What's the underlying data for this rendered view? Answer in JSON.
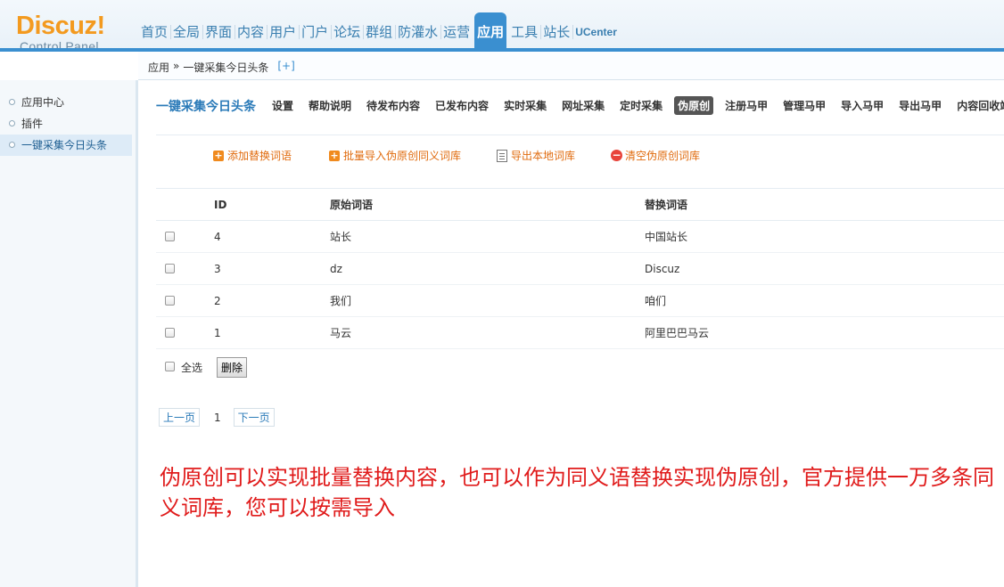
{
  "logo": {
    "word": "Discuz!",
    "sub": "Control Panel"
  },
  "nav": [
    "首页",
    "全局",
    "界面",
    "内容",
    "用户",
    "门户",
    "论坛",
    "群组",
    "防灌水",
    "运营",
    "应用",
    "工具",
    "站长",
    "UCenter"
  ],
  "nav_active": "应用",
  "breadcrumb": {
    "root": "应用",
    "sep": "»",
    "current": "一键采集今日头条",
    "add": "[+]"
  },
  "sidebar": {
    "items": [
      "应用中心",
      "插件",
      "一键采集今日头条"
    ]
  },
  "subnav": {
    "title": "一键采集今日头条",
    "tabs": [
      "设置",
      "帮助说明",
      "待发布内容",
      "已发布内容",
      "实时采集",
      "网址采集",
      "定时采集",
      "伪原创",
      "注册马甲",
      "管理马甲",
      "导入马甲",
      "导出马甲",
      "内容回收站"
    ]
  },
  "actions": [
    "添加替换词语",
    "批量导入伪原创同义词库",
    "导出本地词库",
    "清空伪原创词库"
  ],
  "table": {
    "headers": [
      "ID",
      "原始词语",
      "替换词语"
    ],
    "rows": [
      {
        "id": "4",
        "src": "站长",
        "rep": "中国站长"
      },
      {
        "id": "3",
        "src": "dz",
        "rep": "Discuz"
      },
      {
        "id": "2",
        "src": "我们",
        "rep": "咱们"
      },
      {
        "id": "1",
        "src": "马云",
        "rep": "阿里巴巴马云"
      }
    ]
  },
  "footer": {
    "select_all": "全选",
    "delete": "删除"
  },
  "pager": {
    "prev": "上一页",
    "current": "1",
    "next": "下一页"
  },
  "note": "伪原创可以实现批量替换内容，也可以作为同义语替换实现伪原创，官方提供一万多条同义词库，您可以按需导入"
}
